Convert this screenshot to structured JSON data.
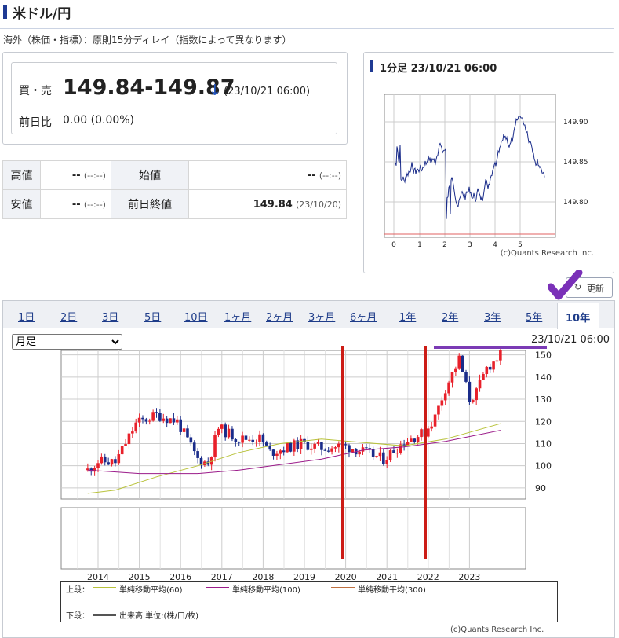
{
  "header": {
    "title": "米ドル/円"
  },
  "notice": "海外（株価・指標）：原則15分ディレイ（指数によって異なります）",
  "quote": {
    "bid_ask_label": "買・売",
    "bid_ask_value": "149.84-149.87",
    "arrow": "↓",
    "time": "(23/10/21 06:00)",
    "change_label": "前日比",
    "change_value": "0.00 (0.00%)"
  },
  "ohlc": {
    "high_label": "高値",
    "high_value": "--",
    "high_time": "(--:--)",
    "open_label": "始値",
    "open_value": "--",
    "open_time": "(--:--)",
    "low_label": "安値",
    "low_value": "--",
    "low_time": "(--:--)",
    "prev_close_label": "前日終値",
    "prev_close_value": "149.84",
    "prev_close_time": "(23/10/20)"
  },
  "intraday": {
    "header": "1分足 23/10/21 06:00",
    "copyright": "(c)Quants Research Inc.",
    "y_ticks": [
      "149.90",
      "149.85",
      "149.80"
    ],
    "x_ticks": [
      "0",
      "1",
      "2",
      "3",
      "4",
      "5"
    ]
  },
  "refresh_label": "更新",
  "tabs": [
    "1日",
    "2日",
    "3日",
    "5日",
    "10日",
    "1ヶ月",
    "2ヶ月",
    "3ヶ月",
    "6ヶ月",
    "1年",
    "2年",
    "3年",
    "5年",
    "10年"
  ],
  "active_tab": "10年",
  "period_select": {
    "selected": "月足"
  },
  "chart_time": "23/10/21 06:00",
  "chart_data": {
    "type": "candlestick",
    "xlabel": "",
    "ylabel": "",
    "x_ticks": [
      "2014",
      "2015",
      "2016",
      "2017",
      "2018",
      "2019",
      "2020",
      "2021",
      "2022",
      "2023"
    ],
    "y_ticks": [
      150,
      140,
      130,
      120,
      110,
      100,
      90
    ],
    "ylim": [
      85,
      152
    ],
    "anchor_closes": [
      {
        "date": "2013-10",
        "close": 98
      },
      {
        "date": "2014-01",
        "close": 102
      },
      {
        "date": "2014-06",
        "close": 101.5
      },
      {
        "date": "2014-12",
        "close": 119
      },
      {
        "date": "2015-06",
        "close": 123
      },
      {
        "date": "2015-12",
        "close": 120
      },
      {
        "date": "2016-06",
        "close": 103
      },
      {
        "date": "2016-09",
        "close": 101
      },
      {
        "date": "2016-12",
        "close": 117
      },
      {
        "date": "2017-06",
        "close": 112
      },
      {
        "date": "2017-12",
        "close": 112.5
      },
      {
        "date": "2018-03",
        "close": 106
      },
      {
        "date": "2018-12",
        "close": 110
      },
      {
        "date": "2019-06",
        "close": 108
      },
      {
        "date": "2019-12",
        "close": 109
      },
      {
        "date": "2020-03",
        "close": 108
      },
      {
        "date": "2020-12",
        "close": 103
      },
      {
        "date": "2021-06",
        "close": 111
      },
      {
        "date": "2021-12",
        "close": 115
      },
      {
        "date": "2022-03",
        "close": 122
      },
      {
        "date": "2022-06",
        "close": 135
      },
      {
        "date": "2022-10",
        "close": 148
      },
      {
        "date": "2023-01",
        "close": 130
      },
      {
        "date": "2023-03",
        "close": 133
      },
      {
        "date": "2023-06",
        "close": 144
      },
      {
        "date": "2023-10",
        "close": 149.8
      }
    ],
    "ma_60": [
      {
        "date": "2013-10",
        "value": 87.5
      },
      {
        "date": "2014-06",
        "value": 89
      },
      {
        "date": "2015-06",
        "value": 95
      },
      {
        "date": "2016-06",
        "value": 100
      },
      {
        "date": "2017-06",
        "value": 106
      },
      {
        "date": "2018-06",
        "value": 110
      },
      {
        "date": "2019-06",
        "value": 112
      },
      {
        "date": "2020-06",
        "value": 110.5
      },
      {
        "date": "2021-06",
        "value": 109
      },
      {
        "date": "2022-06",
        "value": 112
      },
      {
        "date": "2023-10",
        "value": 119
      }
    ],
    "ma_100": [
      {
        "date": "2013-10",
        "value": 98
      },
      {
        "date": "2015-01",
        "value": 96.5
      },
      {
        "date": "2016-06",
        "value": 96.5
      },
      {
        "date": "2017-06",
        "value": 98
      },
      {
        "date": "2018-06",
        "value": 100.5
      },
      {
        "date": "2019-06",
        "value": 103
      },
      {
        "date": "2020-06",
        "value": 107
      },
      {
        "date": "2021-06",
        "value": 108.5
      },
      {
        "date": "2022-06",
        "value": 111
      },
      {
        "date": "2023-10",
        "value": 116
      }
    ],
    "legend": {
      "upper_label": "上段：",
      "lower_label": "下段：",
      "ma60": "単純移動平均(60)",
      "ma100": "単純移動平均(100)",
      "ma300": "単純移動平均(300)",
      "volume": "出来高 単位:(株/口/枚)"
    },
    "copyright": "(c)Quants Research Inc.",
    "colors": {
      "up": "#e8202a",
      "down": "#1a2c8a",
      "ma60": "#b8c23a",
      "ma100": "#9b1b8a",
      "ma300": "#c07040",
      "annotation": "#cc1c16"
    }
  },
  "annotations": {
    "bar_color": "#7b3bb5",
    "check_color": "#7a30b8",
    "line_color": "#cc1c16"
  }
}
